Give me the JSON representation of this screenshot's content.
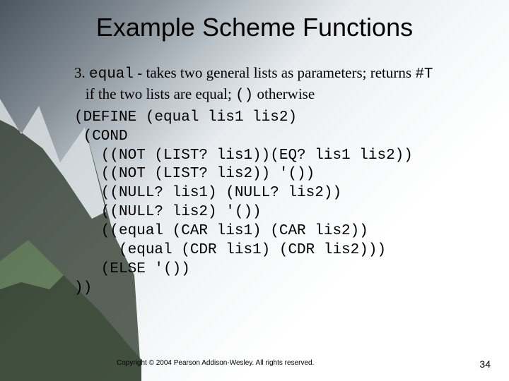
{
  "title": "Example Scheme Functions",
  "intro": {
    "num": "3. ",
    "fn": "equal",
    "mid1": " - takes two general lists as parameters;  returns ",
    "ret": "#T",
    "line2a": "if the two lists are equal; ",
    "empty": "()",
    "line2b": "otherwise"
  },
  "code": "(DEFINE (equal lis1 lis2)\n (COND\n   ((NOT (LIST? lis1))(EQ? lis1 lis2))\n   ((NOT (LIST? lis2)) '())\n   ((NULL? lis1) (NULL? lis2))\n   ((NULL? lis2) '())\n   ((equal (CAR lis1) (CAR lis2))\n     (equal (CDR lis1) (CDR lis2)))\n   (ELSE '())\n))",
  "footer": "Copyright © 2004 Pearson Addison-Wesley. All rights reserved.",
  "pagenum": "34"
}
